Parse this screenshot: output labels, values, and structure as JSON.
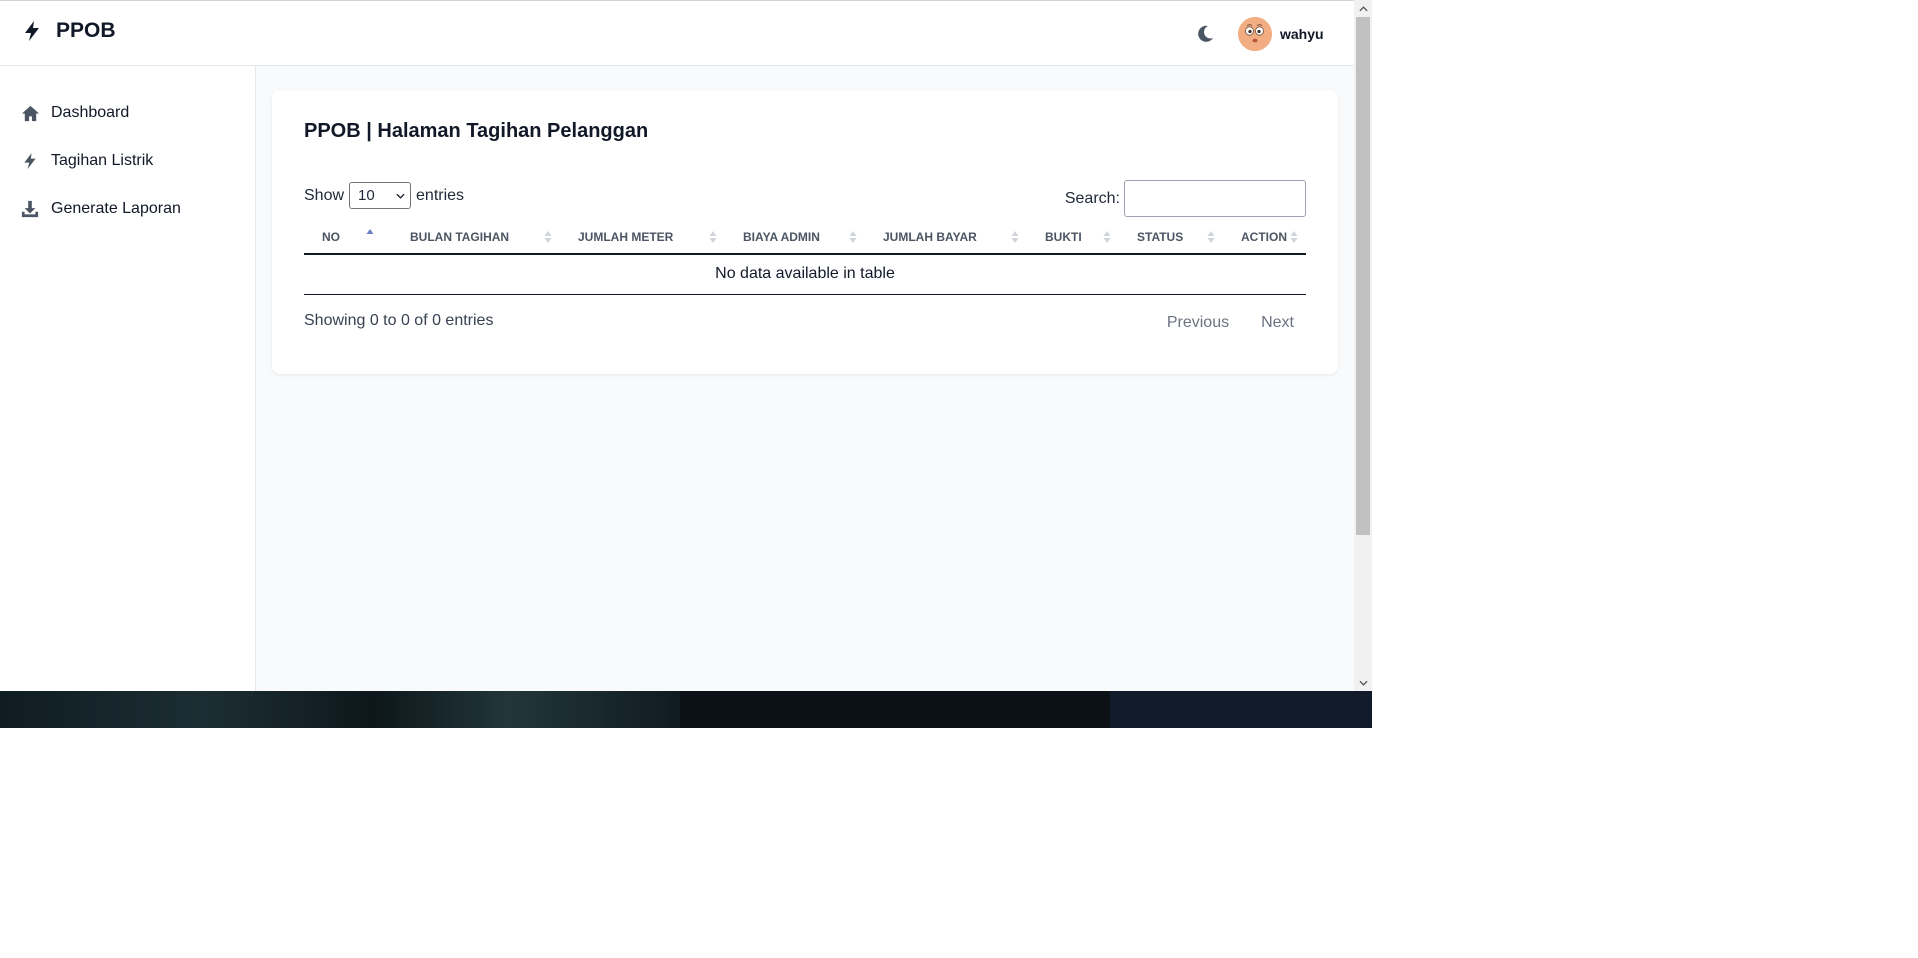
{
  "header": {
    "brand": "PPOB",
    "user_name": "wahyu"
  },
  "sidebar": {
    "items": [
      {
        "label": "Dashboard",
        "icon": "home-icon"
      },
      {
        "label": "Tagihan Listrik",
        "icon": "bolt-icon"
      },
      {
        "label": "Generate Laporan",
        "icon": "download-icon"
      }
    ]
  },
  "main": {
    "title": "PPOB | Halaman Tagihan Pelanggan",
    "length": {
      "prefix": "Show",
      "value": "10",
      "suffix": "entries"
    },
    "search": {
      "label": "Search:",
      "value": ""
    },
    "table": {
      "columns": [
        "NO",
        "BULAN TAGIHAN",
        "JUMLAH METER",
        "BIAYA ADMIN",
        "JUMLAH BAYAR",
        "BUKTI",
        "STATUS",
        "ACTION"
      ],
      "empty_message": "No data available in table"
    },
    "info": "Showing 0 to 0 of 0 entries",
    "pagination": {
      "previous": "Previous",
      "next": "Next"
    }
  },
  "colors": {
    "accent_sort": "#6b7fc4",
    "text": "#111827",
    "muted": "#6b7280"
  }
}
